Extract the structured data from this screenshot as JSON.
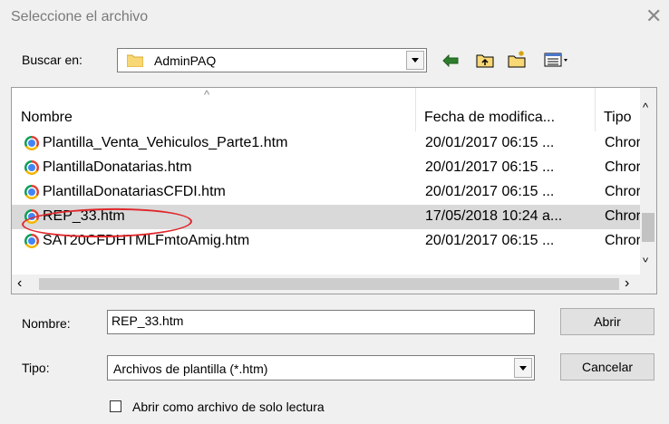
{
  "dialog": {
    "title": "Seleccione el archivo"
  },
  "lookin": {
    "label": "Buscar en:",
    "folder": "AdminPAQ"
  },
  "toolbar": {
    "back_icon": "back-arrow-icon",
    "up_icon": "up-folder-icon",
    "newfolder_icon": "new-folder-icon",
    "view_icon": "view-menu-icon"
  },
  "columns": {
    "name": "Nombre",
    "date": "Fecha de modifica...",
    "type": "Tipo"
  },
  "files": [
    {
      "name": "Plantilla_Venta_Vehiculos_Parte1.htm",
      "date": "20/01/2017 06:15 ...",
      "type": "Chror"
    },
    {
      "name": "PlantillaDonatarias.htm",
      "date": "20/01/2017 06:15 ...",
      "type": "Chror"
    },
    {
      "name": "PlantillaDonatariasCFDI.htm",
      "date": "20/01/2017 06:15 ...",
      "type": "Chror"
    },
    {
      "name": "REP_33.htm",
      "date": "17/05/2018 10:24 a...",
      "type": "Chror"
    },
    {
      "name": "SAT20CFDHTMLFmtoAmig.htm",
      "date": "20/01/2017 06:15 ...",
      "type": "Chror"
    }
  ],
  "form": {
    "name_label": "Nombre:",
    "name_value": "REP_33.htm",
    "type_label": "Tipo:",
    "type_value": "Archivos de plantilla (*.htm)",
    "readonly_label": "Abrir como archivo de solo lectura"
  },
  "buttons": {
    "open": "Abrir",
    "cancel": "Cancelar"
  },
  "colors": {
    "selection": "#d9d9d9",
    "highlight_oval": "#e0262a",
    "folder": "#f8d775"
  }
}
